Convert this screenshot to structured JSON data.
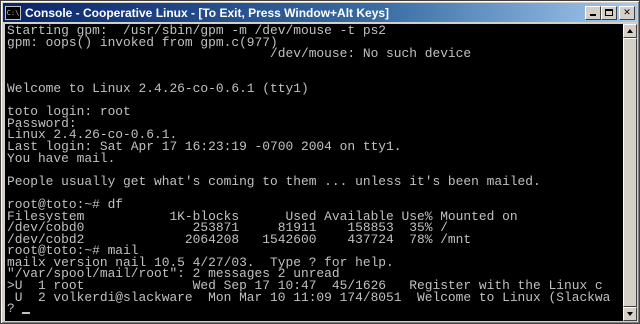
{
  "window": {
    "title": "Console - Cooperative Linux - [To Exit, Press Window+Alt Keys]",
    "icon_label": "C:\\",
    "buttons": {
      "minimize": "minimize",
      "maximize": "maximize",
      "close": "✕"
    }
  },
  "console": {
    "lines": [
      "Starting gpm:  /usr/sbin/gpm -m /dev/mouse -t ps2",
      "gpm: oops() invoked from gpm.c(977)",
      "                                  /dev/mouse: No such device",
      "",
      "",
      "Welcome to Linux 2.4.26-co-0.6.1 (tty1)",
      "",
      "toto login: root",
      "Password:",
      "Linux 2.4.26-co-0.6.1.",
      "Last login: Sat Apr 17 16:23:19 -0700 2004 on tty1.",
      "You have mail.",
      "",
      "People usually get what's coming to them ... unless it's been mailed.",
      "",
      "root@toto:~# df",
      "Filesystem           1K-blocks      Used Available Use% Mounted on",
      "/dev/cobd0              253871     81911    158853  35% /",
      "/dev/cobd2             2064208   1542600    437724  78% /mnt",
      "root@toto:~# mail",
      "mailx version nail 10.5 4/27/03.  Type ? for help.",
      "\"/var/spool/mail/root\": 2 messages 2 unread",
      ">U  1 root              Wed Sep 17 10:47  45/1626   Register with the Linux c",
      " U  2 volkerdi@slackware  Mon Mar 10 11:09 174/8051  Welcome to Linux (Slackwa",
      "? "
    ]
  }
}
